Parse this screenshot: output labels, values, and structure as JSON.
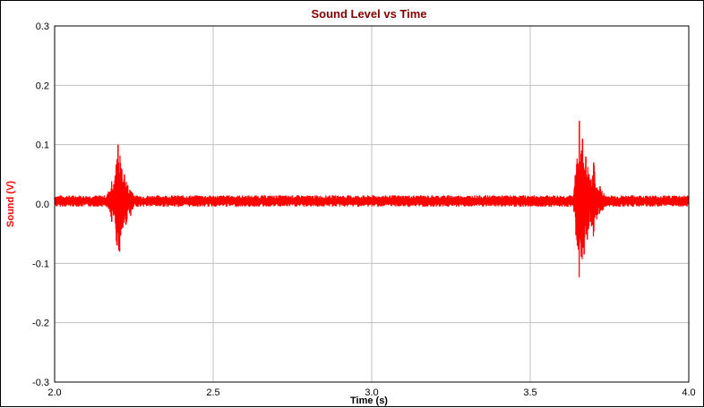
{
  "chart_data": {
    "type": "line",
    "title": "Sound Level vs Time",
    "xlabel": "Time (s)",
    "ylabel": "Sound (V)",
    "xlim": [
      2.0,
      4.0
    ],
    "ylim": [
      -0.3,
      0.3
    ],
    "x_ticks": [
      "2.0",
      "2.5",
      "3.0",
      "3.5",
      "4.0"
    ],
    "y_ticks": [
      "0.3",
      "0.2",
      "0.1",
      "0.0",
      "-0.1",
      "-0.2",
      "-0.3"
    ],
    "grid": true,
    "baseline": 0.005,
    "series": [
      {
        "color": "#ff0000",
        "x": [
          2.0,
          2.1,
          2.15,
          2.17,
          2.18,
          2.19,
          2.195,
          2.2,
          2.205,
          2.21,
          2.215,
          2.22,
          2.225,
          2.23,
          2.24,
          2.25,
          2.26,
          2.28,
          2.3,
          2.5,
          3.0,
          3.5,
          3.6,
          3.64,
          3.655,
          3.66,
          3.665,
          3.67,
          3.675,
          3.68,
          3.685,
          3.69,
          3.7,
          3.71,
          3.72,
          3.73,
          3.75,
          3.8,
          4.0
        ],
        "y": [
          0.005,
          0.005,
          0.01,
          0.02,
          -0.03,
          0.04,
          -0.05,
          0.1,
          -0.08,
          0.06,
          -0.04,
          0.05,
          -0.035,
          0.03,
          -0.02,
          0.01,
          0.006,
          0.005,
          0.005,
          0.005,
          0.005,
          0.005,
          0.005,
          0.01,
          0.14,
          -0.05,
          0.11,
          -0.085,
          0.08,
          -0.06,
          0.05,
          -0.03,
          0.07,
          -0.02,
          0.03,
          -0.01,
          0.01,
          0.005,
          0.005
        ]
      }
    ]
  },
  "colors": {
    "title": "#800000",
    "ylabel": "#ff0000",
    "grid": "#c0c0c0",
    "series": "#ff0000"
  }
}
